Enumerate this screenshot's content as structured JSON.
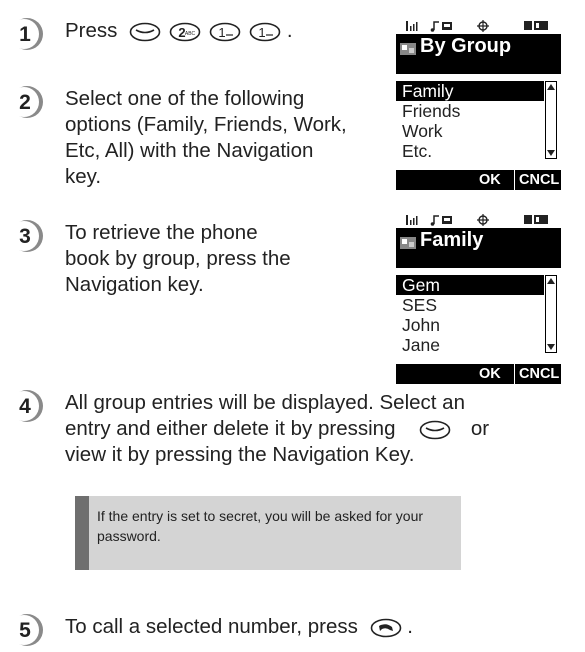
{
  "steps": {
    "s1": {
      "number": "1",
      "text": "Press",
      "end": "."
    },
    "s2": {
      "number": "2",
      "lines": [
        "Select one of the following",
        "options (Family, Friends, Work,",
        "Etc, All) with the Navigation",
        "key."
      ]
    },
    "s3": {
      "number": "3",
      "lines": [
        "To retrieve the phone",
        "book by group, press the",
        "Navigation key."
      ]
    },
    "s4": {
      "number": "4",
      "lines": [
        "All group entries will be displayed. Select an",
        "entry and either delete it by pressing",
        "or",
        "view it by pressing the Navigation Key."
      ]
    },
    "s5": {
      "number": "5",
      "text": "To call a selected number, press",
      "end": "."
    }
  },
  "keys": {
    "k_clear": "clear-key",
    "k_2": "2ABC",
    "k_1a": "1",
    "k_1b": "1",
    "k_send": "send-key"
  },
  "screen1": {
    "title": "By Group",
    "items": [
      "Family",
      "Friends",
      "Work",
      "Etc."
    ],
    "selected_index": 0,
    "softkeys": {
      "left": "OK",
      "right": "CNCL"
    }
  },
  "screen2": {
    "title": "Family",
    "items": [
      "Gem",
      "SES",
      "John",
      "Jane"
    ],
    "selected_index": 0,
    "softkeys": {
      "left": "OK",
      "right": "CNCL"
    }
  },
  "note": {
    "text": "If the entry is set to secret, you will be asked for your password."
  },
  "colors": {
    "number_badge": "#8a8a8a",
    "note_bg": "#d4d4d4",
    "note_bar": "#6f6f6f"
  }
}
